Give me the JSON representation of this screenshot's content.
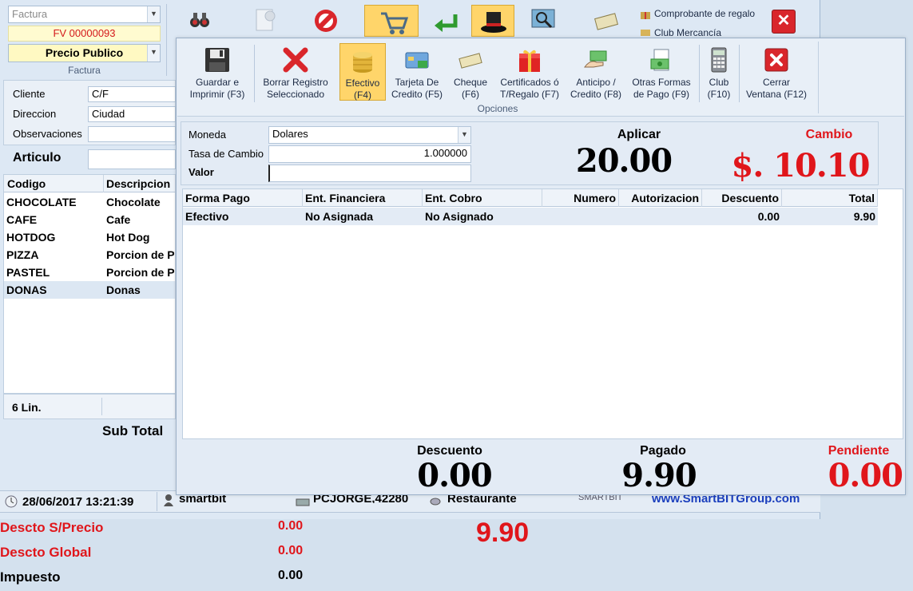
{
  "invoice": {
    "doc_type": "Factura",
    "number": "FV 00000093",
    "price_list": "Precio Publico",
    "group_label": "Factura"
  },
  "customer": {
    "cliente_label": "Cliente",
    "cliente_value": "C/F",
    "direccion_label": "Direccion",
    "direccion_value": "Ciudad",
    "observaciones_label": "Observaciones",
    "observaciones_value": ""
  },
  "articulo": {
    "label": "Articulo",
    "value": ""
  },
  "bg_toolbar": {
    "comprobante": "Comprobante de regalo",
    "club": "Club Mercancía"
  },
  "items_table": {
    "headers": [
      "Codigo",
      "Descripcion"
    ],
    "rows": [
      {
        "codigo": "CHOCOLATE",
        "descripcion": "Chocolate"
      },
      {
        "codigo": "CAFE",
        "descripcion": "Cafe"
      },
      {
        "codigo": "HOTDOG",
        "descripcion": "Hot Dog"
      },
      {
        "codigo": "PIZZA",
        "descripcion": "Porcion de P"
      },
      {
        "codigo": "PASTEL",
        "descripcion": "Porcion de P"
      },
      {
        "codigo": "DONAS",
        "descripcion": "Donas"
      }
    ],
    "lines": "6 Lin."
  },
  "subtotal_label": "Sub Total",
  "statusbar": {
    "datetime": "28/06/2017 13:21:39",
    "user": "smartbit",
    "pc": "PCJORGE,42280",
    "area": "Restaurante",
    "brand": "SMARTBIT",
    "website": "www.SmartBITGroup.com"
  },
  "totals": {
    "descto_precio_label": "Descto S/Precio",
    "descto_precio_value": "0.00",
    "descto_global_label": "Descto Global",
    "descto_global_value": "0.00",
    "impuesto_label": "Impuesto",
    "impuesto_value": "0.00",
    "grand_total": "9.90"
  },
  "payment_toolbar": {
    "group_label": "Opciones",
    "buttons": [
      {
        "line1": "Guardar e",
        "line2": "Imprimir (F3)"
      },
      {
        "line1": "Borrar Registro",
        "line2": "Seleccionado"
      },
      {
        "line1": "Efectivo",
        "line2": "(F4)"
      },
      {
        "line1": "Tarjeta De",
        "line2": "Credito (F5)"
      },
      {
        "line1": "Cheque",
        "line2": "(F6)"
      },
      {
        "line1": "Certificados ó",
        "line2": "T/Regalo (F7)"
      },
      {
        "line1": "Anticipo /",
        "line2": "Credito (F8)"
      },
      {
        "line1": "Otras Formas",
        "line2": "de Pago (F9)"
      },
      {
        "line1": "Club",
        "line2": "(F10)"
      },
      {
        "line1": "Cerrar",
        "line2": "Ventana (F12)"
      }
    ]
  },
  "payment_form": {
    "moneda_label": "Moneda",
    "moneda_value": "Dolares",
    "tasa_label": "Tasa de Cambio",
    "tasa_value": "1.000000",
    "valor_label": "Valor",
    "valor_value": "",
    "aplicar_label": "Aplicar",
    "aplicar_value": "20.00",
    "cambio_label": "Cambio",
    "cambio_value": "$. 10.10"
  },
  "payments_table": {
    "headers": [
      "Forma Pago",
      "Ent. Financiera",
      "Ent. Cobro",
      "Numero",
      "Autorizacion",
      "Descuento",
      "Total"
    ],
    "rows": [
      {
        "forma": "Efectivo",
        "financiera": "No Asignada",
        "cobro": "No Asignado",
        "numero": "",
        "autorizacion": "",
        "descuento": "0.00",
        "total": "9.90"
      }
    ]
  },
  "payment_summary": {
    "descuento_label": "Descuento",
    "descuento_value": "0.00",
    "pagado_label": "Pagado",
    "pagado_value": "9.90",
    "pendiente_label": "Pendiente",
    "pendiente_value": "0.00"
  },
  "colors": {
    "accent_red": "#e0161b",
    "highlight": "#ffd24d"
  }
}
